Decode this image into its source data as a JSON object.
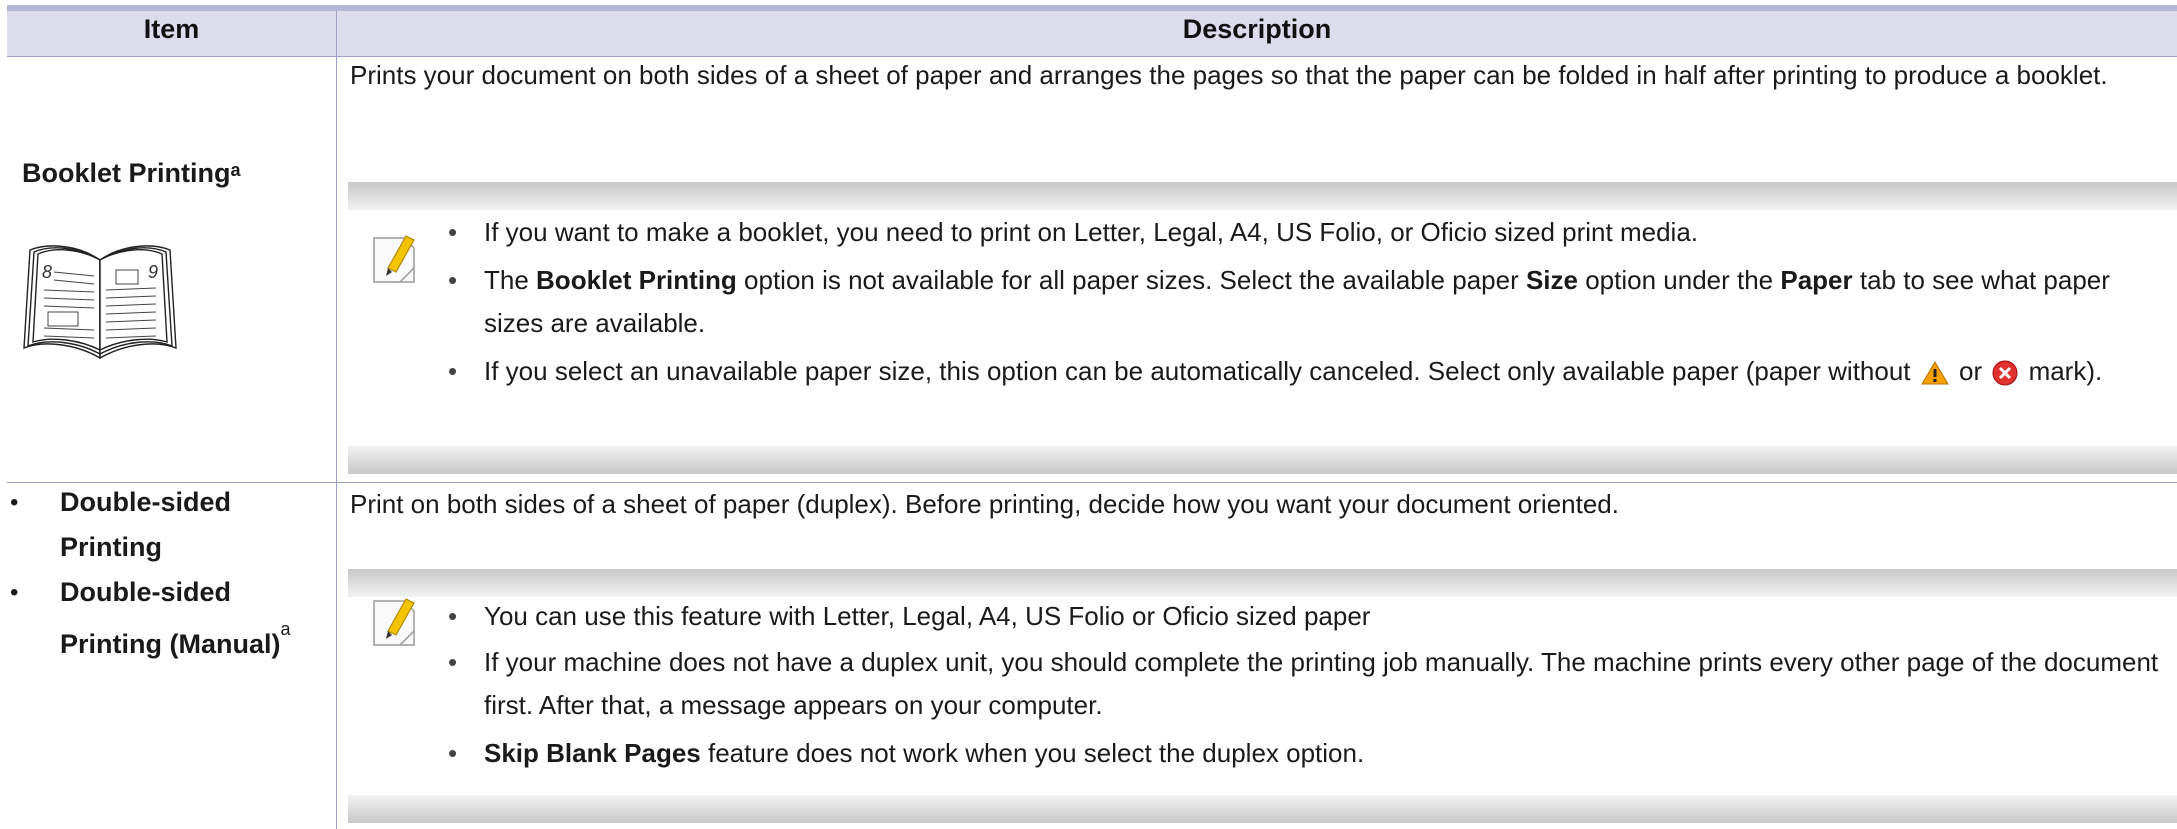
{
  "header": {
    "item": "Item",
    "description": "Description"
  },
  "rows": [
    {
      "item_title": "Booklet Printing",
      "item_sup": "a",
      "description": "Prints your document on both sides of a sheet of paper and arranges the pages so that the paper can be folded in half after printing to produce a booklet.",
      "illustration": {
        "icon": "booklet-icon",
        "page_left": "8",
        "page_right": "9"
      },
      "note": {
        "icon": "note-pencil-icon",
        "bullets": [
          {
            "text": "If you want to make a booklet, you need to print on Letter, Legal, A4, US Folio, or Oficio sized print media."
          },
          {
            "p1": "The ",
            "b1": "Booklet Printing",
            "p2": " option is not available for all paper sizes. Select the available paper ",
            "b2": "Size",
            "p3": " option under the ",
            "b3": "Paper",
            "p4": " tab to see what paper sizes are available."
          },
          {
            "p1": "If you select an unavailable paper size, this option can be automatically canceled. Select only available paper (paper without ",
            "p2": " or ",
            "p3": " mark).",
            "icon1": "warning-icon",
            "icon2": "error-icon"
          }
        ]
      }
    },
    {
      "items": [
        {
          "label": "Double-sided Printing",
          "sup": ""
        },
        {
          "label": "Double-sided Printing (Manual)",
          "sup": "a"
        }
      ],
      "description": "Print on both sides of a sheet of paper (duplex). Before printing, decide how you want your document oriented.",
      "note": {
        "icon": "note-pencil-icon",
        "bullets": [
          {
            "text": "You can use this feature with Letter, Legal, A4, US Folio or Oficio sized paper"
          },
          {
            "text": "If your machine does not have a duplex unit, you should complete the printing job manually. The machine prints every other page of the document first. After that, a message appears on your computer."
          },
          {
            "b1": "Skip Blank Pages",
            "p1": " feature does not work when you select the duplex option."
          }
        ]
      }
    }
  ],
  "colors": {
    "header_bg": "#dcdced",
    "rule": "#9fa1c2",
    "top_rule": "#b5b7d6",
    "note_band": "#c8c8c8",
    "warning": "#f5a000",
    "error": "#e03030"
  }
}
